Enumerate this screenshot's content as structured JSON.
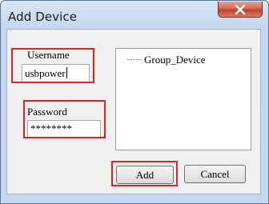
{
  "window": {
    "title": "Add Device",
    "close_icon": "close-icon"
  },
  "form": {
    "username_label": "Username",
    "username_value": "usbpower",
    "password_label": "Password",
    "password_value": "********"
  },
  "tree": {
    "items": [
      "Group_Device"
    ]
  },
  "buttons": {
    "add_label": "Add",
    "cancel_label": "Cancel"
  },
  "colors": {
    "highlight": "#e0202a",
    "close_button": "#c1402a"
  }
}
